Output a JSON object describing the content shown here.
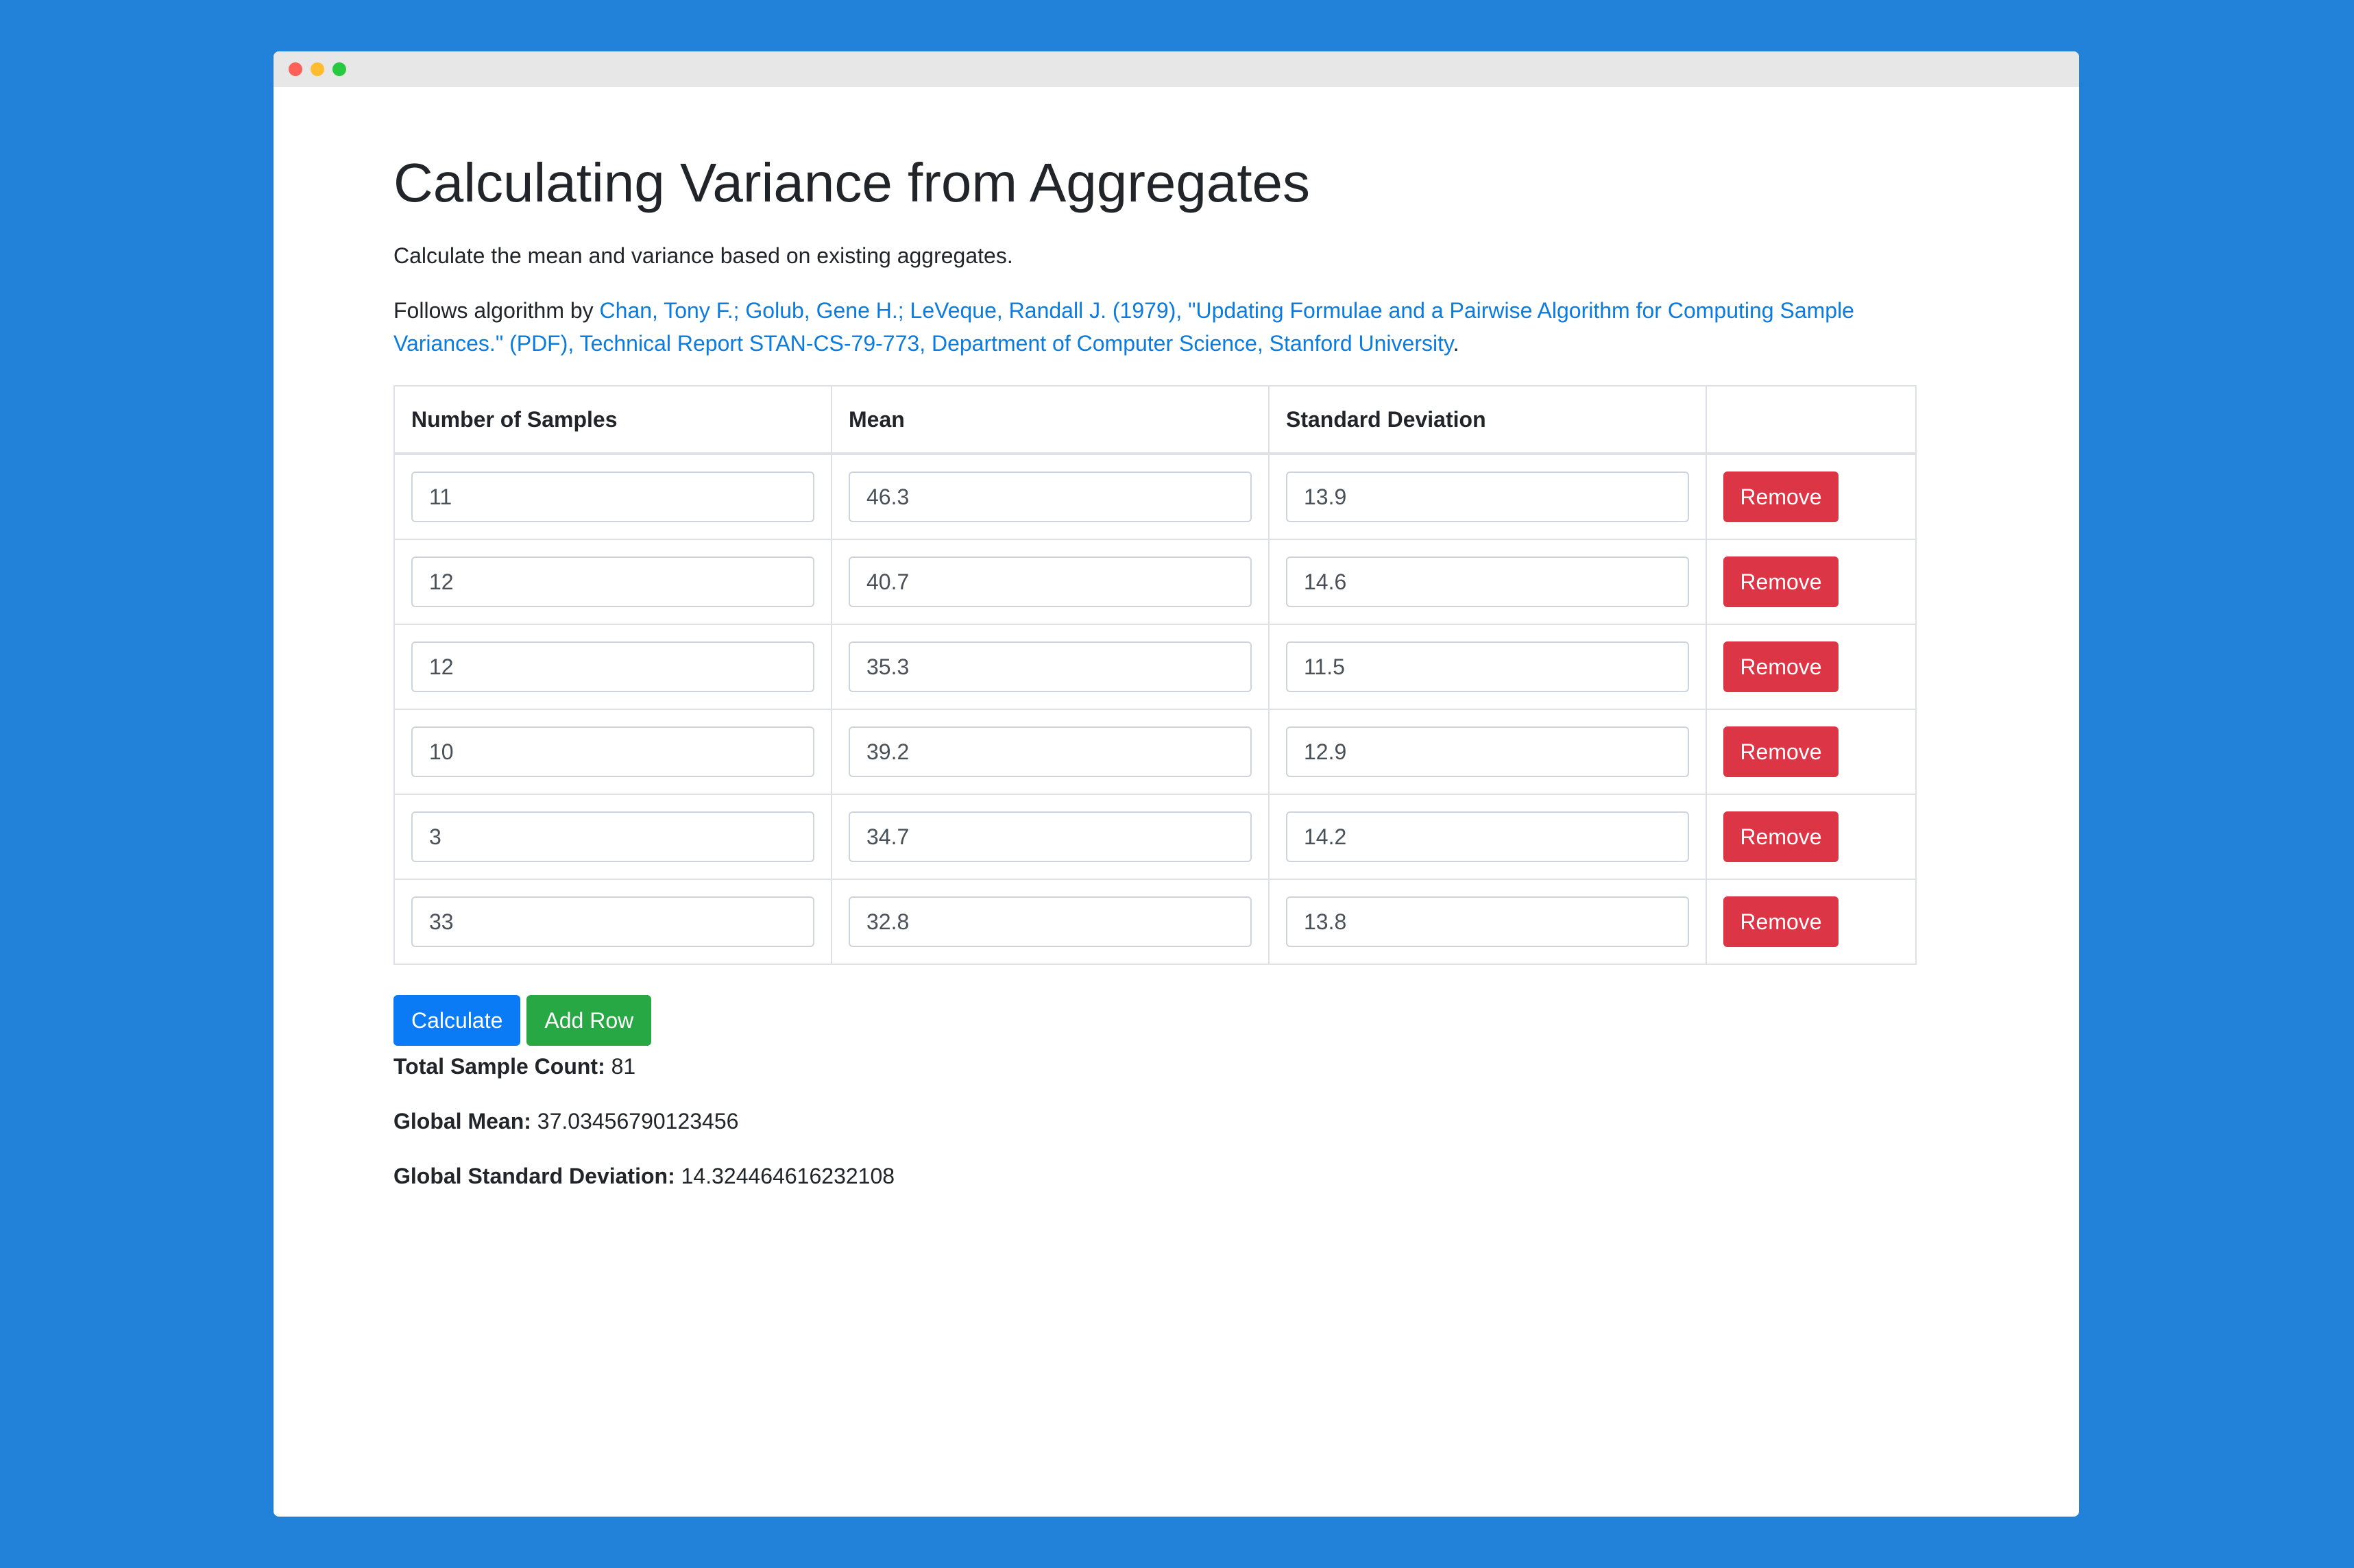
{
  "page": {
    "title": "Calculating Variance from Aggregates",
    "lead": "Calculate the mean and variance based on existing aggregates.",
    "follows_prefix": "Follows algorithm by ",
    "citation_link": "Chan, Tony F.; Golub, Gene H.; LeVeque, Randall J. (1979), \"Updating Formulae and a Pairwise Algorithm for Computing Sample Variances.\" (PDF), Technical Report STAN-CS-79-773, Department of Computer Science, Stanford University",
    "follows_suffix": "."
  },
  "table": {
    "headers": [
      "Number of Samples",
      "Mean",
      "Standard Deviation",
      ""
    ],
    "remove_label": "Remove",
    "rows": [
      {
        "n": "11",
        "mean": "46.3",
        "sd": "13.9"
      },
      {
        "n": "12",
        "mean": "40.7",
        "sd": "14.6"
      },
      {
        "n": "12",
        "mean": "35.3",
        "sd": "11.5"
      },
      {
        "n": "10",
        "mean": "39.2",
        "sd": "12.9"
      },
      {
        "n": "3",
        "mean": "34.7",
        "sd": "14.2"
      },
      {
        "n": "33",
        "mean": "32.8",
        "sd": "13.8"
      }
    ]
  },
  "actions": {
    "calculate_label": "Calculate",
    "add_row_label": "Add Row"
  },
  "results": {
    "total_label": "Total Sample Count:",
    "total_value": "81",
    "mean_label": "Global Mean:",
    "mean_value": "37.03456790123456",
    "sd_label": "Global Standard Deviation:",
    "sd_value": "14.324464616232108"
  },
  "colors": {
    "background": "#2282da",
    "link": "#0a7bdf",
    "danger": "#dc3545",
    "primary": "#0a7bf4",
    "success": "#28a745"
  }
}
